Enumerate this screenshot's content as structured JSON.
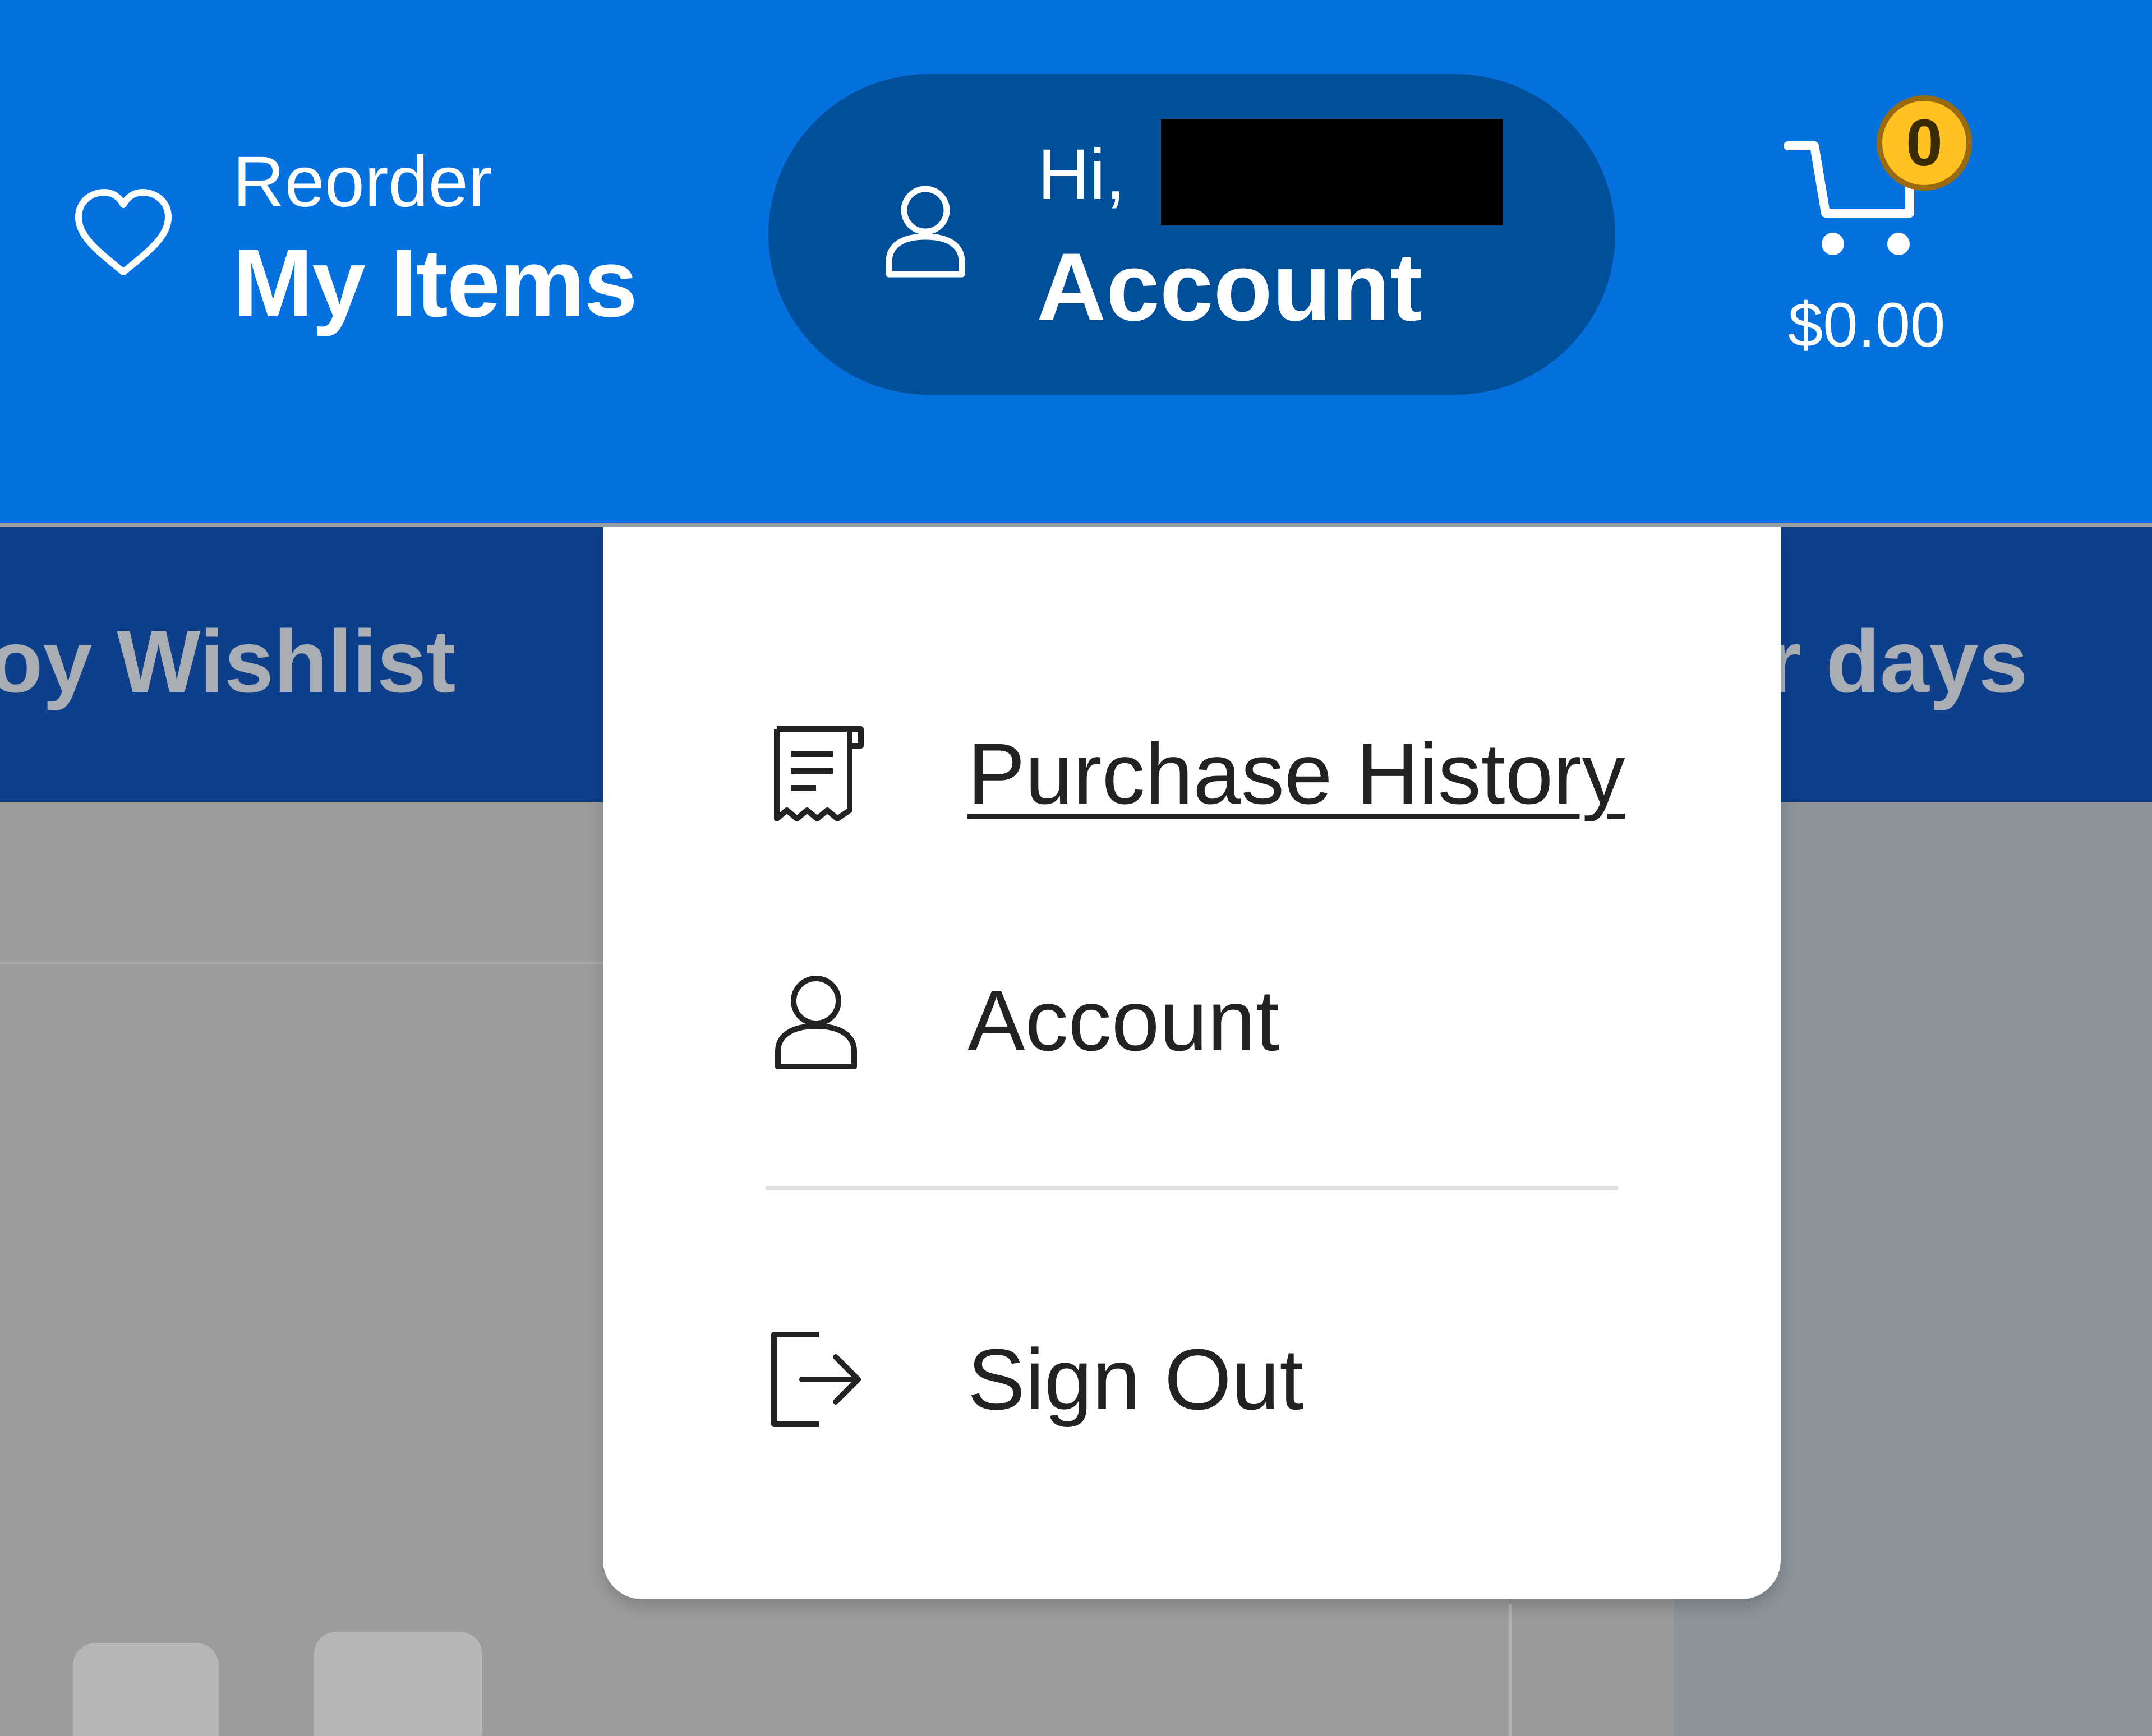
{
  "header": {
    "reorder": {
      "small_label": "Reorder",
      "big_label": "My Items",
      "icon": "heart-icon"
    },
    "account": {
      "greeting": "Hi,",
      "name_redacted": true,
      "label": "Account",
      "icon": "user-icon"
    },
    "cart": {
      "count": "0",
      "total": "$0.00",
      "icon": "cart-icon"
    }
  },
  "subnav": {
    "left_partial": "oy Wishlist",
    "right_partial": "r days"
  },
  "dropdown": {
    "items": [
      {
        "label": "Purchase History",
        "icon": "receipt-icon"
      },
      {
        "label": "Account",
        "icon": "user-icon"
      },
      {
        "label": "Sign Out",
        "icon": "sign-out-icon"
      }
    ]
  },
  "colors": {
    "header_blue": "#0571de",
    "pill_blue": "#004f9a",
    "subnav_blue": "#0e3f8a",
    "badge_yellow": "#ffc220"
  }
}
